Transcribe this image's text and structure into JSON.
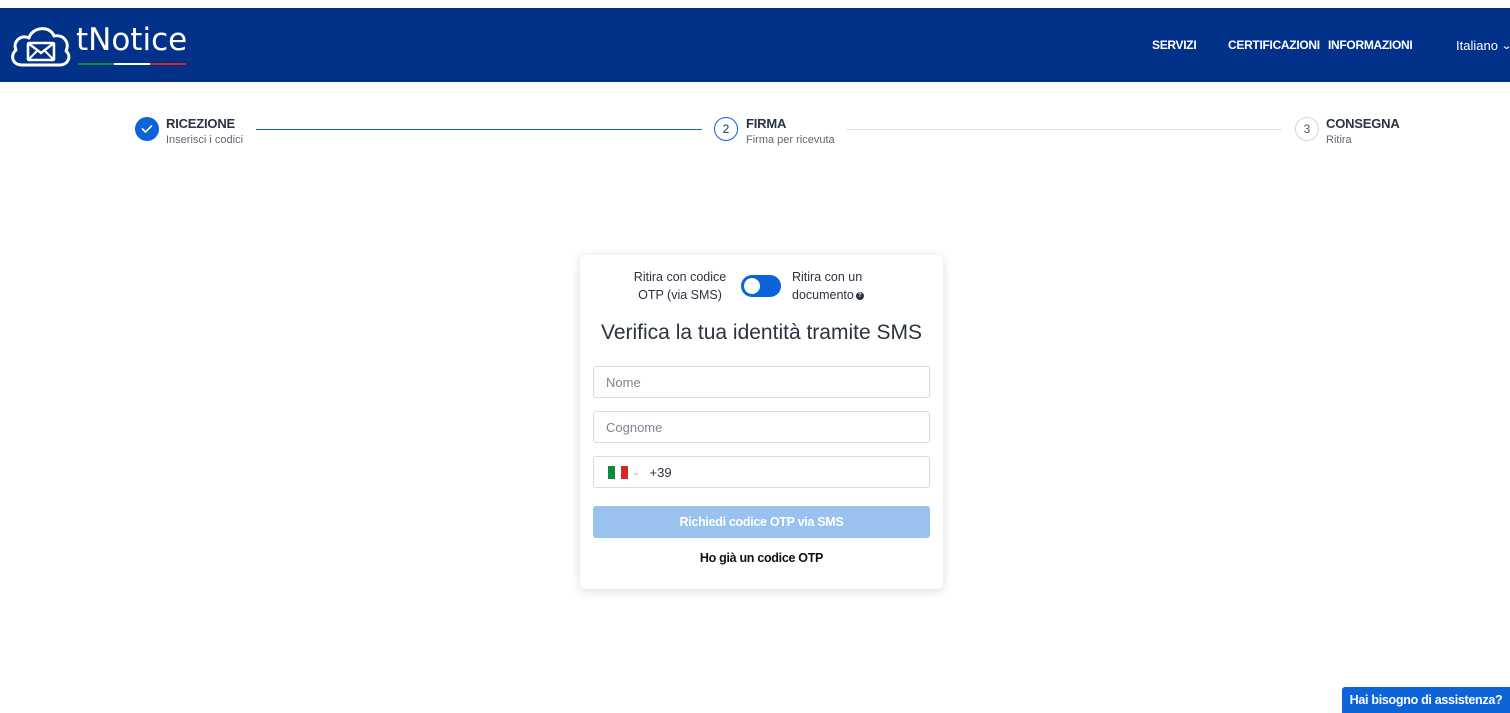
{
  "header": {
    "logo_text": "tNotice",
    "nav": [
      "SERVIZI",
      "CERTIFICAZIONI",
      "INFORMAZIONI"
    ],
    "language": "Italiano",
    "flag_colors": [
      "#0a8a3a",
      "#ffffff",
      "#d6262b"
    ]
  },
  "stepper": {
    "steps": [
      {
        "number": "1",
        "title": "RICEZIONE",
        "subtitle": "Inserisci i codici",
        "status": "done"
      },
      {
        "number": "2",
        "title": "FIRMA",
        "subtitle": "Firma per ricevuta",
        "status": "active"
      },
      {
        "number": "3",
        "title": "CONSEGNA",
        "subtitle": "Ritira",
        "status": "pending"
      }
    ]
  },
  "card": {
    "toggle_left_label": "Ritira con codice OTP (via SMS)",
    "toggle_right_label": "Ritira con un documento",
    "title": "Verifica la tua identità tramite SMS",
    "first_name_placeholder": "Nome",
    "last_name_placeholder": "Cognome",
    "phone_prefix": "+39",
    "submit_label": "Richiedi codice OTP via SMS",
    "otp_link": "Ho già un codice OTP"
  },
  "help_button": "Hai bisogno di assistenza?",
  "colors": {
    "header_bg": "#013188",
    "primary": "#0c64d8",
    "button_disabled": "#99c2ee"
  }
}
